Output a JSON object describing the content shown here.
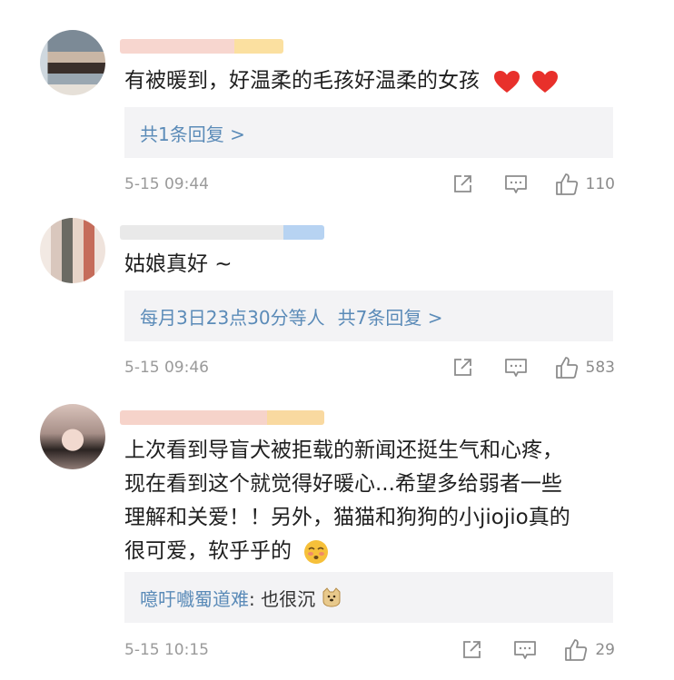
{
  "comments": [
    {
      "text_lines": [
        "有被暖到，好温柔的毛孩好温柔的女孩"
      ],
      "reply_summary": "共1条回复 >",
      "time": "5-15 09:44",
      "likes": "110"
    },
    {
      "text_lines": [
        "姑娘真好 ~"
      ],
      "reply_user": "每月3日23点30分等人",
      "reply_summary": "共7条回复 >",
      "time": "5-15 09:46",
      "likes": "583"
    },
    {
      "text_lines": [
        "上次看到导盲犬被拒载的新闻还挺生气和心疼，",
        "现在看到这个就觉得好暖心...希望多给弱者一些",
        "理解和关爱！！另外，猫猫和狗狗的小jiojio真的",
        "很可爱，软乎乎的"
      ],
      "reply_user": "噫吁嚱蜀道难",
      "reply_text": ": 也很沉",
      "time": "5-15 10:15",
      "likes": "29"
    }
  ],
  "icons": {
    "share": "share-icon",
    "comment": "comment-icon",
    "like": "thumbs-up-icon",
    "heart": "red-heart-emoji",
    "blush": "blush-face-emoji",
    "doge": "doge-emoji"
  },
  "colors": {
    "link": "#5b8bb8",
    "meta": "#9a9a9a",
    "reply_bg": "#f3f3f5",
    "heart": "#e8302b"
  }
}
